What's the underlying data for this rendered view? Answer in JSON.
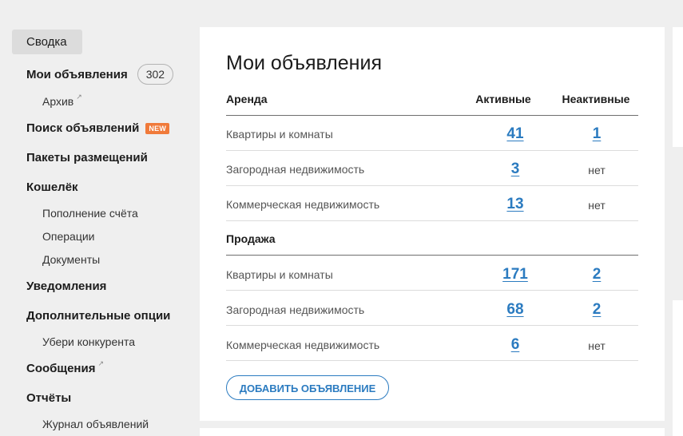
{
  "sidebar": {
    "active": "Сводка",
    "items": [
      {
        "label": "Мои объявления",
        "badge": "302"
      },
      {
        "label": "Архив"
      },
      {
        "label": "Поиск объявлений",
        "tag": "NEW"
      },
      {
        "label": "Пакеты размещений"
      },
      {
        "label": "Кошелёк"
      },
      {
        "label": "Пополнение счёта"
      },
      {
        "label": "Операции"
      },
      {
        "label": "Документы"
      },
      {
        "label": "Уведомления"
      },
      {
        "label": "Дополнительные опции"
      },
      {
        "label": "Убери конкурента"
      },
      {
        "label": "Сообщения"
      },
      {
        "label": "Отчёты"
      },
      {
        "label": "Журнал объявлений"
      }
    ],
    "external_icon": "↗"
  },
  "main": {
    "title": "Мои объявления",
    "columns": {
      "active": "Активные",
      "inactive": "Неактивные"
    },
    "sections": [
      {
        "title": "Аренда",
        "rows": [
          {
            "label": "Квартиры и комнаты",
            "active": "41",
            "inactive": "1"
          },
          {
            "label": "Загородная недвижимость",
            "active": "3",
            "inactive": "нет"
          },
          {
            "label": "Коммерческая недвижимость",
            "active": "13",
            "inactive": "нет"
          }
        ]
      },
      {
        "title": "Продажа",
        "rows": [
          {
            "label": "Квартиры и комнаты",
            "active": "171",
            "inactive": "2"
          },
          {
            "label": "Загородная недвижимость",
            "active": "68",
            "inactive": "2"
          },
          {
            "label": "Коммерческая недвижимость",
            "active": "6",
            "inactive": "нет"
          }
        ]
      }
    ],
    "add_button": "ДОБАВИТЬ ОБЪЯВЛЕНИЕ"
  },
  "colors": {
    "link": "#2b7bc0",
    "new_badge": "#f07a3a",
    "active_nav_bg": "#dcdcdc",
    "page_bg": "#efefef"
  }
}
